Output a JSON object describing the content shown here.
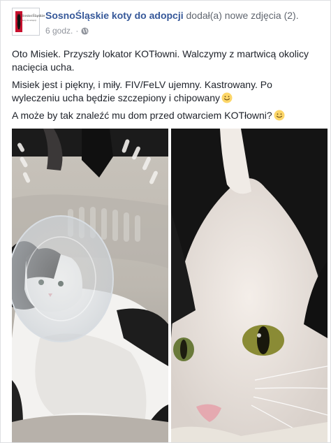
{
  "post": {
    "page_name": "SosnoŚląskie koty do adopcji",
    "action": "dodał(a) nowe zdjęcia (2).",
    "time": "6 godz.",
    "separator": "·",
    "privacy_icon": "globe-icon",
    "avatar_logo": "SosnoŚląskie",
    "avatar_sub": "koty do adopcji",
    "paragraphs": [
      "Oto Misiek. Przyszły lokator KOTłowni. Walczymy z martwicą okolicy nacięcia ucha.",
      "Misiek jest i piękny, i miły. FIV/FeLV ujemny. Kastrowany. Po wyleczeniu ucha będzie szczepiony i chipowany",
      "A może by tak znaleźć mu dom przed otwarciem KOTłowni?"
    ],
    "emoji_icon": "smiling-face-icon"
  },
  "photos": [
    {
      "name": "cat-in-carrier-with-cone-photo"
    },
    {
      "name": "cat-closeup-face-photo"
    }
  ],
  "colors": {
    "link": "#365899",
    "meta": "#90949c",
    "text": "#1d2129"
  }
}
